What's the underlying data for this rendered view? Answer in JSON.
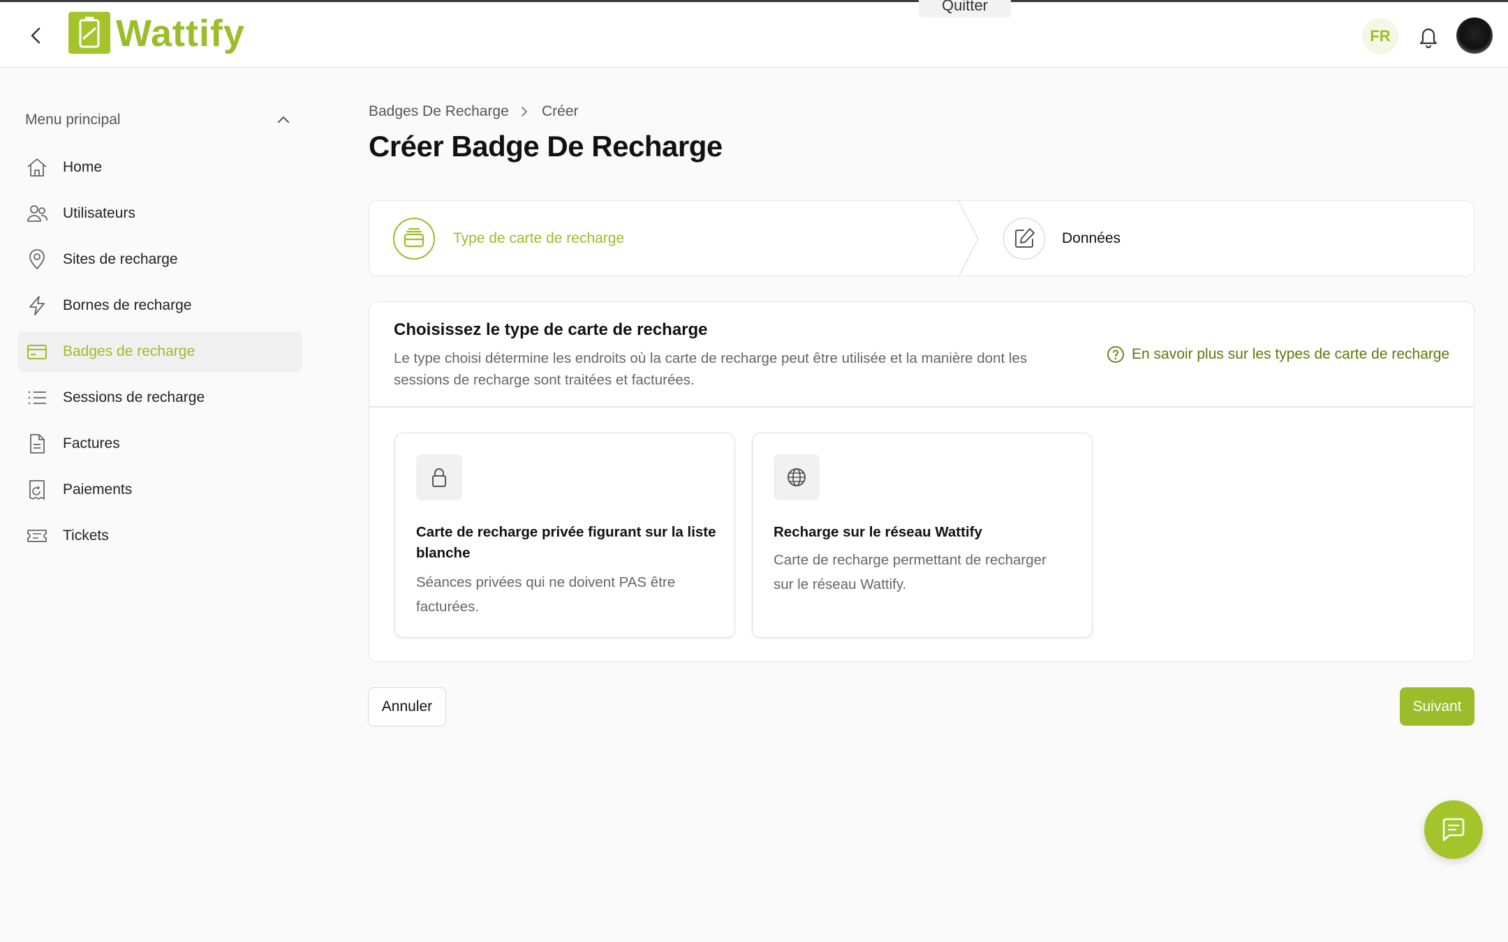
{
  "header": {
    "app_name": "Wattify",
    "quit_label": "Quitter",
    "language": "FR"
  },
  "sidebar": {
    "section_title": "Menu principal",
    "items": [
      {
        "label": "Home",
        "icon": "home-icon"
      },
      {
        "label": "Utilisateurs",
        "icon": "users-icon"
      },
      {
        "label": "Sites de recharge",
        "icon": "location-pin-icon"
      },
      {
        "label": "Bornes de recharge",
        "icon": "lightning-icon"
      },
      {
        "label": "Badges de recharge",
        "icon": "credit-card-icon",
        "active": true
      },
      {
        "label": "Sessions de recharge",
        "icon": "list-icon"
      },
      {
        "label": "Factures",
        "icon": "document-icon"
      },
      {
        "label": "Paiements",
        "icon": "receipt-icon"
      },
      {
        "label": "Tickets",
        "icon": "ticket-icon"
      }
    ]
  },
  "breadcrumb": {
    "parent": "Badges De Recharge",
    "current": "Créer"
  },
  "page_title": "Créer Badge De Recharge",
  "stepper": {
    "steps": [
      {
        "label": "Type de carte de recharge",
        "icon": "card-stack-icon",
        "state": "active"
      },
      {
        "label": "Données",
        "icon": "edit-icon",
        "state": "pending"
      }
    ]
  },
  "panel": {
    "title": "Choisissez le type de carte de recharge",
    "description": "Le type choisi détermine les endroits où la carte de recharge peut être utilisée et la manière dont les sessions de recharge sont traitées et facturées.",
    "help_link": "En savoir plus sur les types de carte de recharge",
    "options": [
      {
        "title": "Carte de recharge privée figurant sur la liste blanche",
        "description": "Séances privées qui ne doivent PAS être facturées.",
        "icon": "lock-icon"
      },
      {
        "title": "Recharge sur le réseau Wattify",
        "description": "Carte de recharge permettant de recharger sur le réseau Wattify.",
        "icon": "globe-icon"
      }
    ]
  },
  "actions": {
    "cancel": "Annuler",
    "next": "Suivant"
  },
  "colors": {
    "accent": "#9bbd29",
    "accent_dark": "#5a7a08",
    "text": "#111111",
    "muted": "#666666"
  }
}
